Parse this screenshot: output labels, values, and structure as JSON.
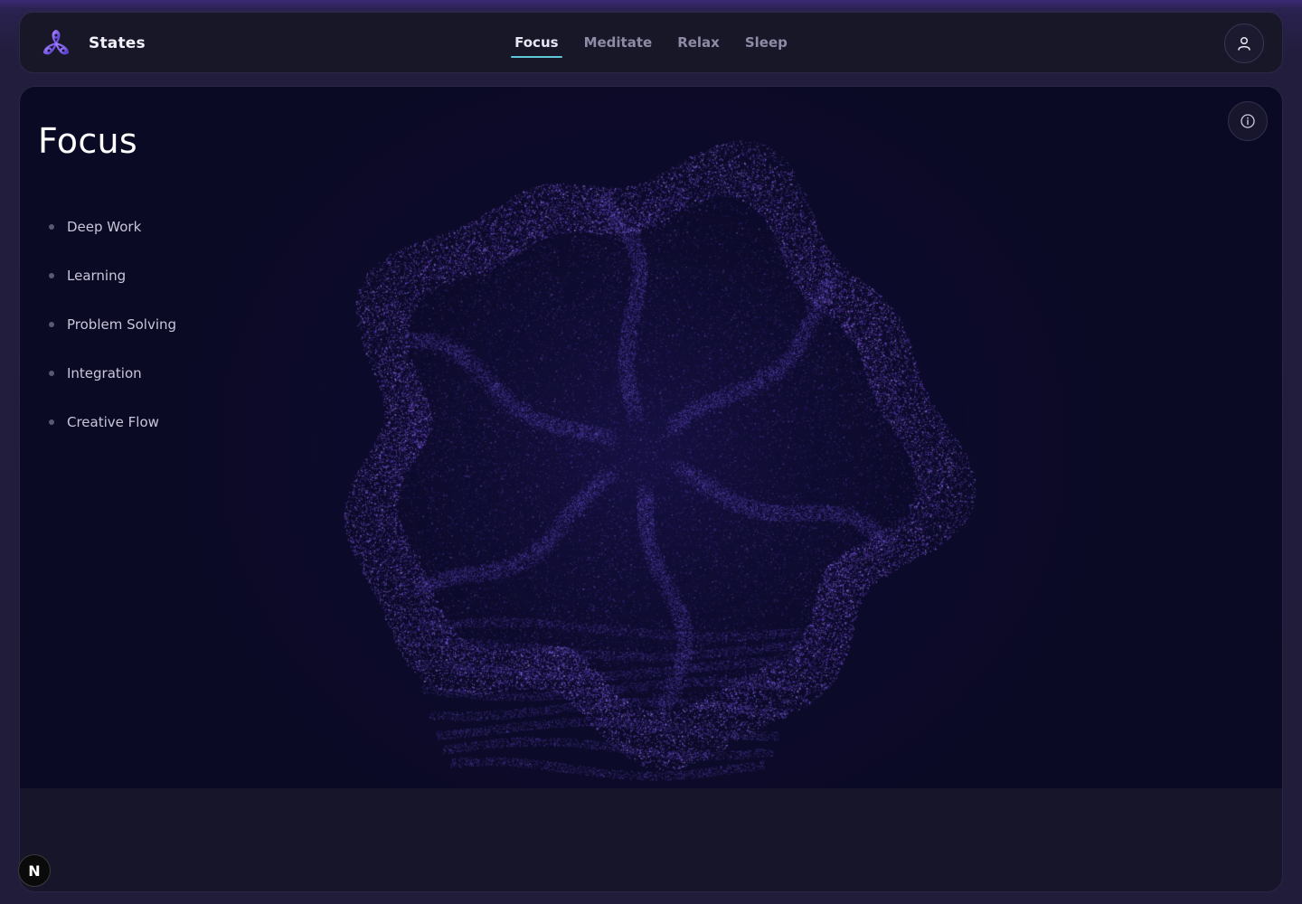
{
  "app": {
    "name": "States",
    "logo_icon": "triskelion-flower-icon",
    "accent_color": "#5fc7d6",
    "brand_color": "#7b5cf0"
  },
  "nav": {
    "tabs": [
      {
        "label": "Focus",
        "active": true
      },
      {
        "label": "Meditate",
        "active": false
      },
      {
        "label": "Relax",
        "active": false
      },
      {
        "label": "Sleep",
        "active": false
      }
    ],
    "user_icon": "user-icon"
  },
  "main": {
    "title": "Focus",
    "info_icon": "info-icon",
    "items": [
      {
        "label": "Deep Work"
      },
      {
        "label": "Learning"
      },
      {
        "label": "Problem Solving"
      },
      {
        "label": "Integration"
      },
      {
        "label": "Creative Flow"
      }
    ],
    "visual": {
      "kind": "particle-sphere",
      "particle_color": "#6a55e0"
    }
  },
  "dev_badge": {
    "label": "N"
  }
}
